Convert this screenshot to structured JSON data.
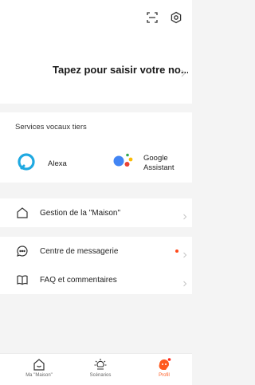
{
  "header": {
    "profile_name": "Tapez pour saisir votre no..."
  },
  "voice_services": {
    "title": "Services vocaux tiers",
    "items": [
      {
        "label": "Alexa"
      },
      {
        "label_line1": "Google",
        "label_line2": "Assistant"
      }
    ]
  },
  "menu": {
    "home_management": "Gestion de la \"Maison\"",
    "messages": "Centre de messagerie",
    "faq": "FAQ et commentaires"
  },
  "tabs": [
    {
      "label": "Ma \"Maison\""
    },
    {
      "label": "Scénarios"
    },
    {
      "label": "Profil"
    }
  ],
  "colors": {
    "accent": "#ff5a1f",
    "alexa": "#1fa9e1"
  }
}
